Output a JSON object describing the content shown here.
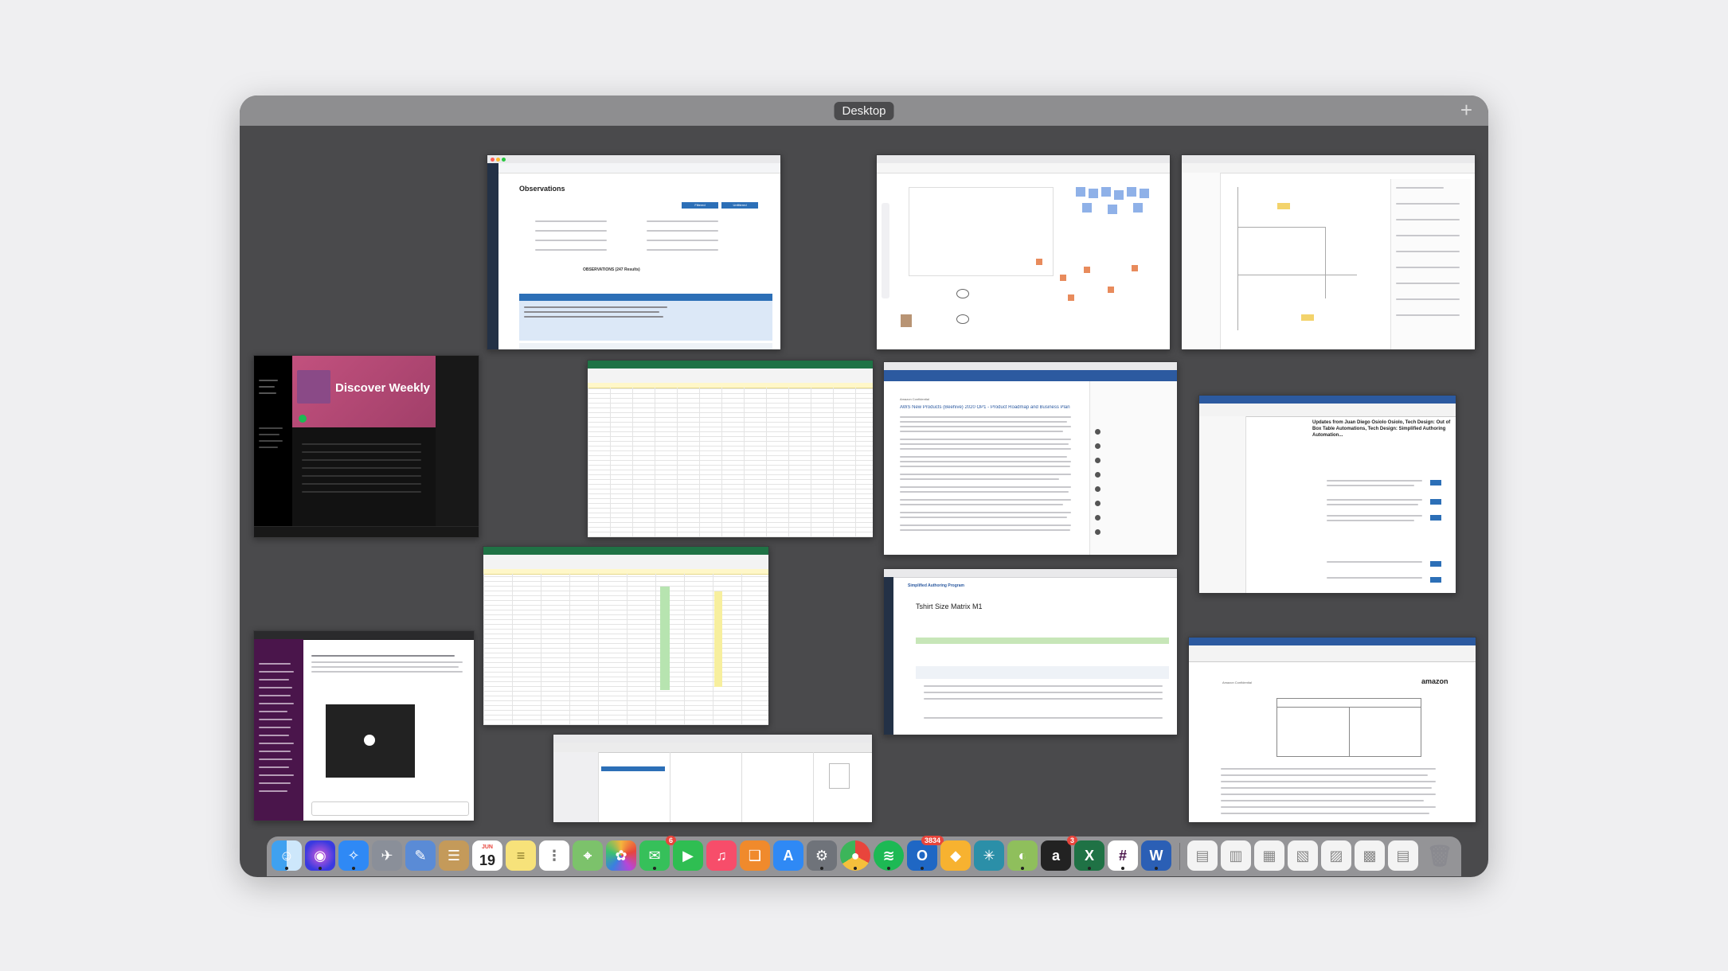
{
  "mission_control": {
    "space_label": "Desktop",
    "add_space_symbol": "+"
  },
  "windows": {
    "observations": {
      "title": "Observations",
      "table_header": "OBSERVATIONS (247 Results)",
      "btn_primary": "Filtered",
      "btn_secondary": "Unfiltered"
    },
    "spotify": {
      "playlist_title": "Discover Weekly"
    },
    "sales_doc": {
      "heading": "AWS New Products (Beehive) 2020 OP1 - Product Roadmap and Business Plan",
      "org": "Amazon Confidential"
    },
    "outlook": {
      "heading": "Updates from Juan Diego Osiolo Osiolo, Tech Design: Out of Box Table Automations, Tech Design: Simplified Authoring Automation..."
    },
    "tshirt": {
      "app_name": "Simplified Authoring Program",
      "title": "Tshirt Size Matrix M1"
    },
    "word_doc": {
      "brand": "amazon",
      "subtitle": "Amazon Confidential"
    }
  },
  "dock": {
    "calendar_day": "19",
    "calendar_month": "JUN",
    "badges": {
      "messages": "6",
      "outlook": "3834",
      "amazon": "3"
    }
  },
  "colors": {
    "frame": "#4a4a4c",
    "titlebar": "#8e8e90",
    "accent_blue": "#2c6fb7",
    "spotify_pink": "#c2517e"
  }
}
